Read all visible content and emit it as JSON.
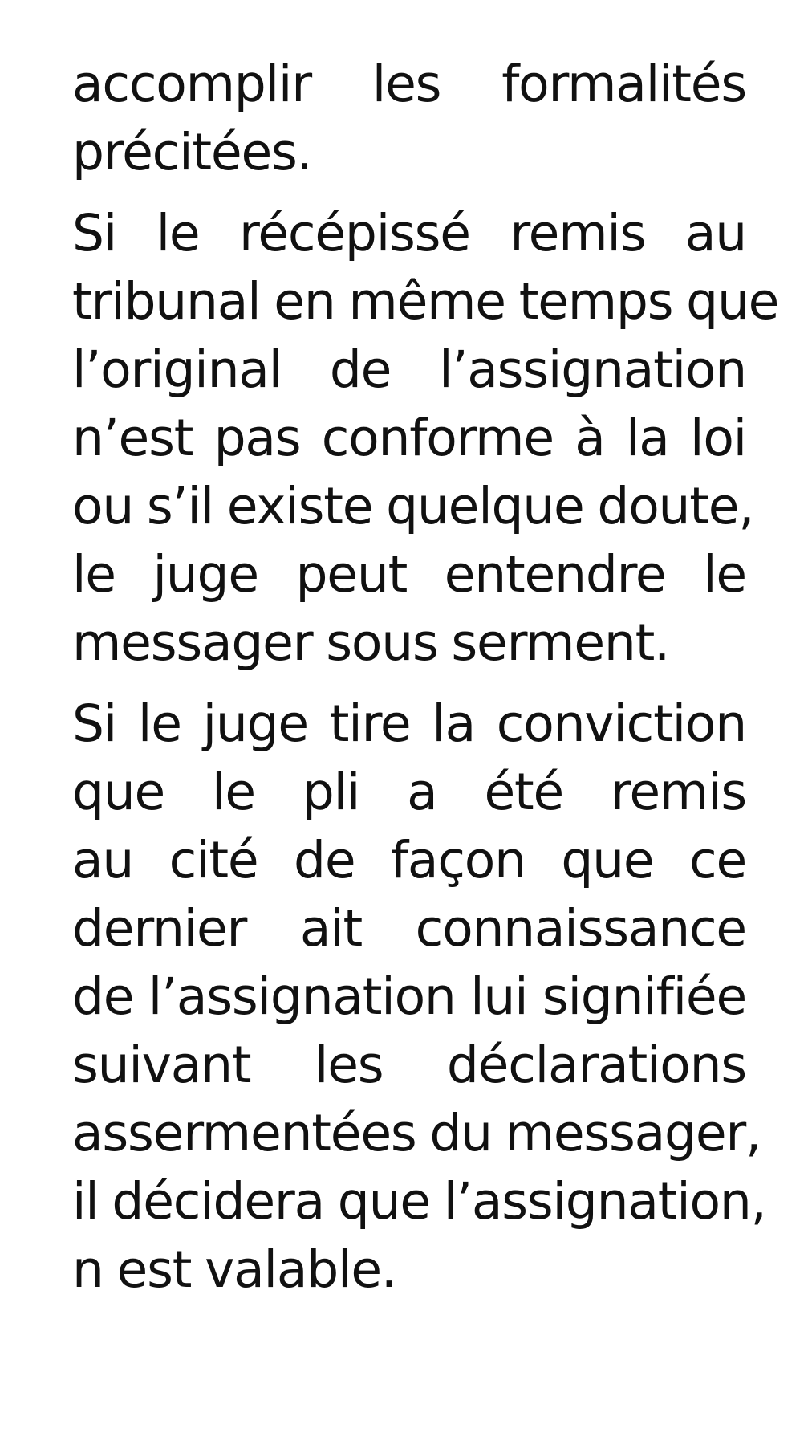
{
  "document": {
    "paragraphs": [
      {
        "lines": [
          "accomplir les formalités",
          "précitées."
        ]
      },
      {
        "lines": [
          "Si le récépissé remis au",
          "tribunal en même temps que",
          "l’original de l’assignation",
          "n’est pas conforme à la loi",
          "ou s’il existe quelque doute,",
          "le juge peut entendre le",
          "messager sous serment."
        ]
      },
      {
        "lines": [
          "Si le juge tire la conviction",
          "que le pli a été remis",
          "au cité de façon que ce",
          "dernier ait connaissance",
          "de l’assignation lui signifiée",
          "suivant les déclarations",
          "assermentées du messager,",
          "il décidera que l’assignation,",
          "n est valable."
        ]
      }
    ]
  }
}
